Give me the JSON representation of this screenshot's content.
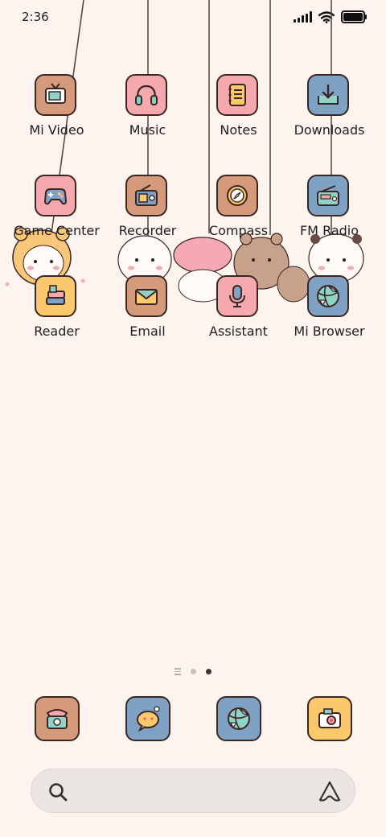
{
  "status_bar": {
    "time": "2:36"
  },
  "apps": [
    {
      "label": "Mi Video",
      "icon": "tv-icon",
      "bg": "#d49a7a"
    },
    {
      "label": "Music",
      "icon": "headphones-icon",
      "bg": "#f5a9ae"
    },
    {
      "label": "Notes",
      "icon": "notebook-icon",
      "bg": "#f5a9ae"
    },
    {
      "label": "Downloads",
      "icon": "download-tray-icon",
      "bg": "#7fa1c4"
    },
    {
      "label": "Game Center",
      "icon": "gamepad-icon",
      "bg": "#f5a9ae"
    },
    {
      "label": "Recorder",
      "icon": "radio-recorder-icon",
      "bg": "#d49a7a"
    },
    {
      "label": "Compass",
      "icon": "compass-icon",
      "bg": "#d49a7a"
    },
    {
      "label": "FM Radio",
      "icon": "fm-radio-icon",
      "bg": "#7fa1c4"
    },
    {
      "label": "Reader",
      "icon": "books-icon",
      "bg": "#fbc96b"
    },
    {
      "label": "Email",
      "icon": "envelope-icon",
      "bg": "#d49a7a"
    },
    {
      "label": "Assistant",
      "icon": "microphone-icon",
      "bg": "#f5a9ae"
    },
    {
      "label": "Mi Browser",
      "icon": "globe-icon",
      "bg": "#7fa1c4"
    }
  ],
  "dock": [
    {
      "icon": "phone-icon",
      "bg": "#d49a7a"
    },
    {
      "icon": "chat-bubble-icon",
      "bg": "#7fa1c4"
    },
    {
      "icon": "globe-icon",
      "bg": "#7fa1c4"
    },
    {
      "icon": "camera-icon",
      "bg": "#fbc96b"
    }
  ],
  "pager": {
    "pages": 2,
    "active": 2
  },
  "search": {
    "placeholder": ""
  }
}
